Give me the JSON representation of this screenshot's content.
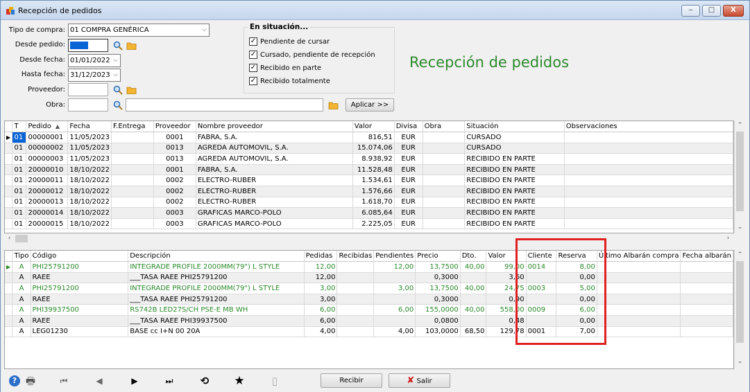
{
  "window": {
    "title": "Recepción de pedidos",
    "min": "‒",
    "max": "□",
    "close": "X"
  },
  "filters": {
    "tipo_compra_label": "Tipo de compra:",
    "tipo_compra_value": "01 COMPRA GENÉRICA",
    "desde_pedido_label": "Desde pedido:",
    "desde_fecha_label": "Desde fecha:",
    "desde_fecha_value": "01/01/2022",
    "hasta_fecha_label": "Hasta fecha:",
    "hasta_fecha_value": "31/12/2023",
    "proveedor_label": "Proveedor:",
    "obra_label": "Obra:",
    "apply_label": "Aplicar >>"
  },
  "situacion": {
    "title": "En situación...",
    "options": [
      {
        "label": "Pendiente de cursar",
        "checked": "✓"
      },
      {
        "label": "Cursado, pendiente de recepción",
        "checked": "✓"
      },
      {
        "label": "Recibido en parte",
        "checked": "✓"
      },
      {
        "label": "Recibido totalmente",
        "checked": "✓"
      }
    ]
  },
  "page_title": "Recepción de pedidos",
  "orders": {
    "columns": [
      "T",
      "Pedido",
      "Fecha",
      "F.Entrega",
      "Proveedor",
      "Nombre proveedor",
      "Valor",
      "Divisa",
      "Obra",
      "Situación",
      "Observaciones"
    ],
    "sort_indicator": "▲",
    "rows": [
      [
        "01",
        "00000001",
        "11/05/2023",
        "",
        "0001",
        "FABRA, S.A.",
        "816,51",
        "EUR",
        "",
        "CURSADO",
        ""
      ],
      [
        "01",
        "00000002",
        "11/05/2023",
        "",
        "0013",
        "AGREDA AUTOMOVIL, S.A.",
        "15.074,06",
        "EUR",
        "",
        "CURSADO",
        ""
      ],
      [
        "01",
        "00000003",
        "11/05/2023",
        "",
        "0013",
        "AGREDA AUTOMOVIL, S.A.",
        "8.938,92",
        "EUR",
        "",
        "RECIBIDO EN PARTE",
        ""
      ],
      [
        "01",
        "20000010",
        "18/10/2022",
        "",
        "0001",
        "FABRA, S.A.",
        "11.528,48",
        "EUR",
        "",
        "RECIBIDO EN PARTE",
        ""
      ],
      [
        "01",
        "20000011",
        "18/10/2022",
        "",
        "0002",
        "ELECTRO-RUBER",
        "1.534,61",
        "EUR",
        "",
        "RECIBIDO EN PARTE",
        ""
      ],
      [
        "01",
        "20000012",
        "18/10/2022",
        "",
        "0002",
        "ELECTRO-RUBER",
        "1.576,66",
        "EUR",
        "",
        "RECIBIDO EN PARTE",
        ""
      ],
      [
        "01",
        "20000013",
        "18/10/2022",
        "",
        "0002",
        "ELECTRO-RUBER",
        "1.618,70",
        "EUR",
        "",
        "RECIBIDO EN PARTE",
        ""
      ],
      [
        "01",
        "20000014",
        "18/10/2022",
        "",
        "0003",
        "GRAFICAS MARCO-POLO",
        "6.085,64",
        "EUR",
        "",
        "RECIBIDO EN PARTE",
        ""
      ],
      [
        "01",
        "20000015",
        "18/10/2022",
        "",
        "0003",
        "GRAFICAS MARCO-POLO",
        "2.225,05",
        "EUR",
        "",
        "RECIBIDO EN PARTE",
        ""
      ]
    ]
  },
  "lines": {
    "columns": [
      "Tipo",
      "Código",
      "Descripción",
      "Pedidas",
      "Recibidas",
      "Pendientes",
      "Precio",
      "Dto.",
      "Valor",
      "Cliente",
      "Reserva",
      "Último Albarán compra",
      "Fecha albarán"
    ],
    "rows": [
      [
        "A",
        "PHI25791200",
        "INTEGRADE PROFILE 2000MM(79\") L STYLE",
        "12,00",
        "",
        "12,00",
        "13,7500",
        "40,00",
        "99,00",
        "0014",
        "8,00",
        "",
        ""
      ],
      [
        "A",
        "RAEE",
        "___TASA RAEE PHI25791200",
        "12,00",
        "",
        "",
        "0,3000",
        "",
        "3,60",
        "",
        "0,00",
        "",
        ""
      ],
      [
        "A",
        "PHI25791200",
        "INTEGRADE PROFILE 2000MM(79\") L STYLE",
        "3,00",
        "",
        "3,00",
        "13,7500",
        "40,00",
        "24,75",
        "0003",
        "5,00",
        "",
        ""
      ],
      [
        "A",
        "RAEE",
        "___TASA RAEE PHI25791200",
        "3,00",
        "",
        "",
        "0,3000",
        "",
        "0,90",
        "",
        "0,00",
        "",
        ""
      ],
      [
        "A",
        "PHI39937500",
        "RS742B LED27S/CH PSE-E MB WH",
        "6,00",
        "",
        "6,00",
        "155,0000",
        "40,00",
        "558,00",
        "0009",
        "6,00",
        "",
        ""
      ],
      [
        "A",
        "RAEE",
        "___TASA RAEE PHI39937500",
        "6,00",
        "",
        "",
        "0,0800",
        "",
        "0,48",
        "",
        "0,00",
        "",
        ""
      ],
      [
        "A",
        "LEG01230",
        "BASE cc I+N 00 20A",
        "4,00",
        "",
        "4,00",
        "103,0000",
        "68,50",
        "129,78",
        "0001",
        "7,00",
        "",
        ""
      ]
    ],
    "green_rows": [
      true,
      false,
      true,
      false,
      true,
      false,
      false
    ]
  },
  "toolbar": {
    "help": "?",
    "print": "🖶",
    "first": "⏮",
    "prev": "◀",
    "next": "▶",
    "last": "⏭",
    "refresh": "⟲",
    "favorite": "★",
    "bookmark": "▯",
    "receive_label": "Recibir",
    "exit_label": "Salir",
    "exit_icon": "✘"
  }
}
